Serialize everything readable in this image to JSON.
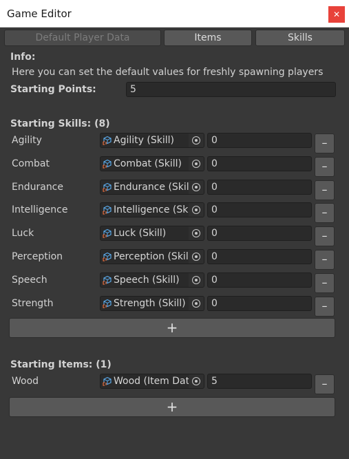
{
  "window": {
    "title": "Game Editor",
    "close_glyph": "✕"
  },
  "tabs": [
    {
      "label": "Default Player Data",
      "active": true
    },
    {
      "label": "Items",
      "active": false
    },
    {
      "label": "Skills",
      "active": false
    }
  ],
  "info": {
    "heading": "Info:",
    "text": "Here you can set the default values for freshly spawning players"
  },
  "starting_points": {
    "label": "Starting Points:",
    "value": "5"
  },
  "skills": {
    "heading": "Starting Skills: (8)",
    "rows": [
      {
        "label": "Agility",
        "object": "Agility (Skill)",
        "value": "0"
      },
      {
        "label": "Combat",
        "object": "Combat (Skill)",
        "value": "0"
      },
      {
        "label": "Endurance",
        "object": "Endurance (Skill)",
        "value": "0"
      },
      {
        "label": "Intelligence",
        "object": "Intelligence (Skill)",
        "value": "0"
      },
      {
        "label": "Luck",
        "object": "Luck (Skill)",
        "value": "0"
      },
      {
        "label": "Perception",
        "object": "Perception (Skill)",
        "value": "0"
      },
      {
        "label": "Speech",
        "object": "Speech (Skill)",
        "value": "0"
      },
      {
        "label": "Strength",
        "object": "Strength (Skill)",
        "value": "0"
      }
    ],
    "add_label": "+"
  },
  "items": {
    "heading": "Starting Items: (1)",
    "rows": [
      {
        "label": "Wood",
        "object": "Wood (Item Data)",
        "value": "5"
      }
    ],
    "add_label": "+"
  },
  "remove_label": "–",
  "icons": {
    "close": "close-icon",
    "object_type": "scriptable-object-icon",
    "picker": "object-picker-icon"
  },
  "colors": {
    "background": "#383838",
    "close_button": "#e8423a",
    "button": "#585858",
    "field": "#2a2a2a"
  }
}
